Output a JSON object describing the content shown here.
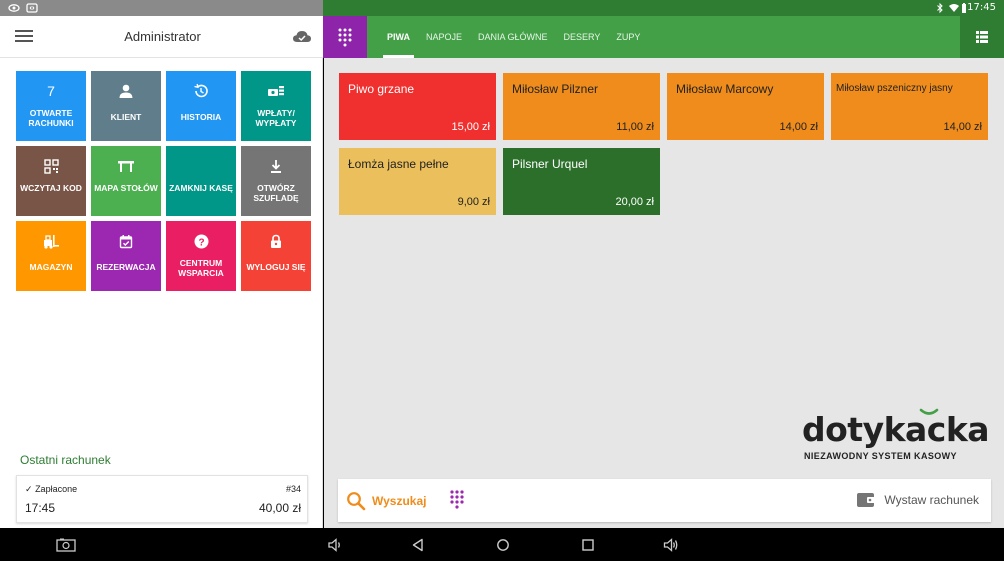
{
  "status_bar": {
    "time": "17:45"
  },
  "left_panel": {
    "title": "Administrator",
    "tiles": [
      {
        "label": "Otwarte rachunki",
        "icon": "count-badge",
        "badge": "7",
        "color": "#2196f3"
      },
      {
        "label": "Klient",
        "icon": "person-icon",
        "color": "#607d8b"
      },
      {
        "label": "Historia",
        "icon": "history-icon",
        "color": "#2196f3"
      },
      {
        "label": "Wpłaty/ wypłaty",
        "icon": "cash-icon",
        "color": "#009688"
      },
      {
        "label": "Wczytaj kod",
        "icon": "qr-code-icon",
        "color": "#795548"
      },
      {
        "label": "Mapa stołów",
        "icon": "table-icon",
        "color": "#4caf50"
      },
      {
        "label": "Zamknij kasę",
        "icon": "none",
        "color": "#009688"
      },
      {
        "label": "Otwórz szufladę",
        "icon": "download-icon",
        "color": "#757575"
      },
      {
        "label": "Magazyn",
        "icon": "forklift-icon",
        "color": "#ff9800"
      },
      {
        "label": "Rezerwacja",
        "icon": "calendar-check-icon",
        "color": "#9c27b0"
      },
      {
        "label": "Centrum wsparcia",
        "icon": "help-icon",
        "color": "#e91e63"
      },
      {
        "label": "Wyloguj się",
        "icon": "lock-icon",
        "color": "#f44336"
      }
    ],
    "last_receipt": {
      "heading": "Ostatni rachunek",
      "status": "Zapłacone",
      "number": "#34",
      "time": "17:45",
      "total": "40,00 zł"
    }
  },
  "categories": {
    "active": "Piwa",
    "tabs": [
      "Piwa",
      "Napoje",
      "Dania główne",
      "Desery",
      "Zupy"
    ]
  },
  "products": [
    {
      "name": "Piwo grzane",
      "price": "15,00 zł",
      "color": "#f0302e",
      "text_color": "#ffffff"
    },
    {
      "name": "Miłosław Pilzner",
      "price": "11,00 zł",
      "color": "#ef8c1b",
      "text_color": "#222222"
    },
    {
      "name": "Miłosław Marcowy",
      "price": "14,00 zł",
      "color": "#ef8c1b",
      "text_color": "#222222"
    },
    {
      "name": "Miłosław pszeniczny jasny",
      "price": "14,00 zł",
      "color": "#ef8c1b",
      "text_color": "#222222"
    },
    {
      "name": "Łomża jasne pełne",
      "price": "9,00 zł",
      "color": "#ebc05c",
      "text_color": "#222222"
    },
    {
      "name": "Pilsner Urquel",
      "price": "20,00 zł",
      "color": "#2b6f2b",
      "text_color": "#ffffff"
    }
  ],
  "branding": {
    "logo": "dotykacka",
    "tagline": "NIEZAWODNY SYSTEM KASOWY"
  },
  "bottom_bar": {
    "search_label": "Wyszukaj",
    "issue_label": "Wystaw rachunek"
  },
  "colors": {
    "accent_green": "#43a047",
    "accent_purple": "#8e24aa",
    "accent_orange": "#ef8c1b"
  }
}
